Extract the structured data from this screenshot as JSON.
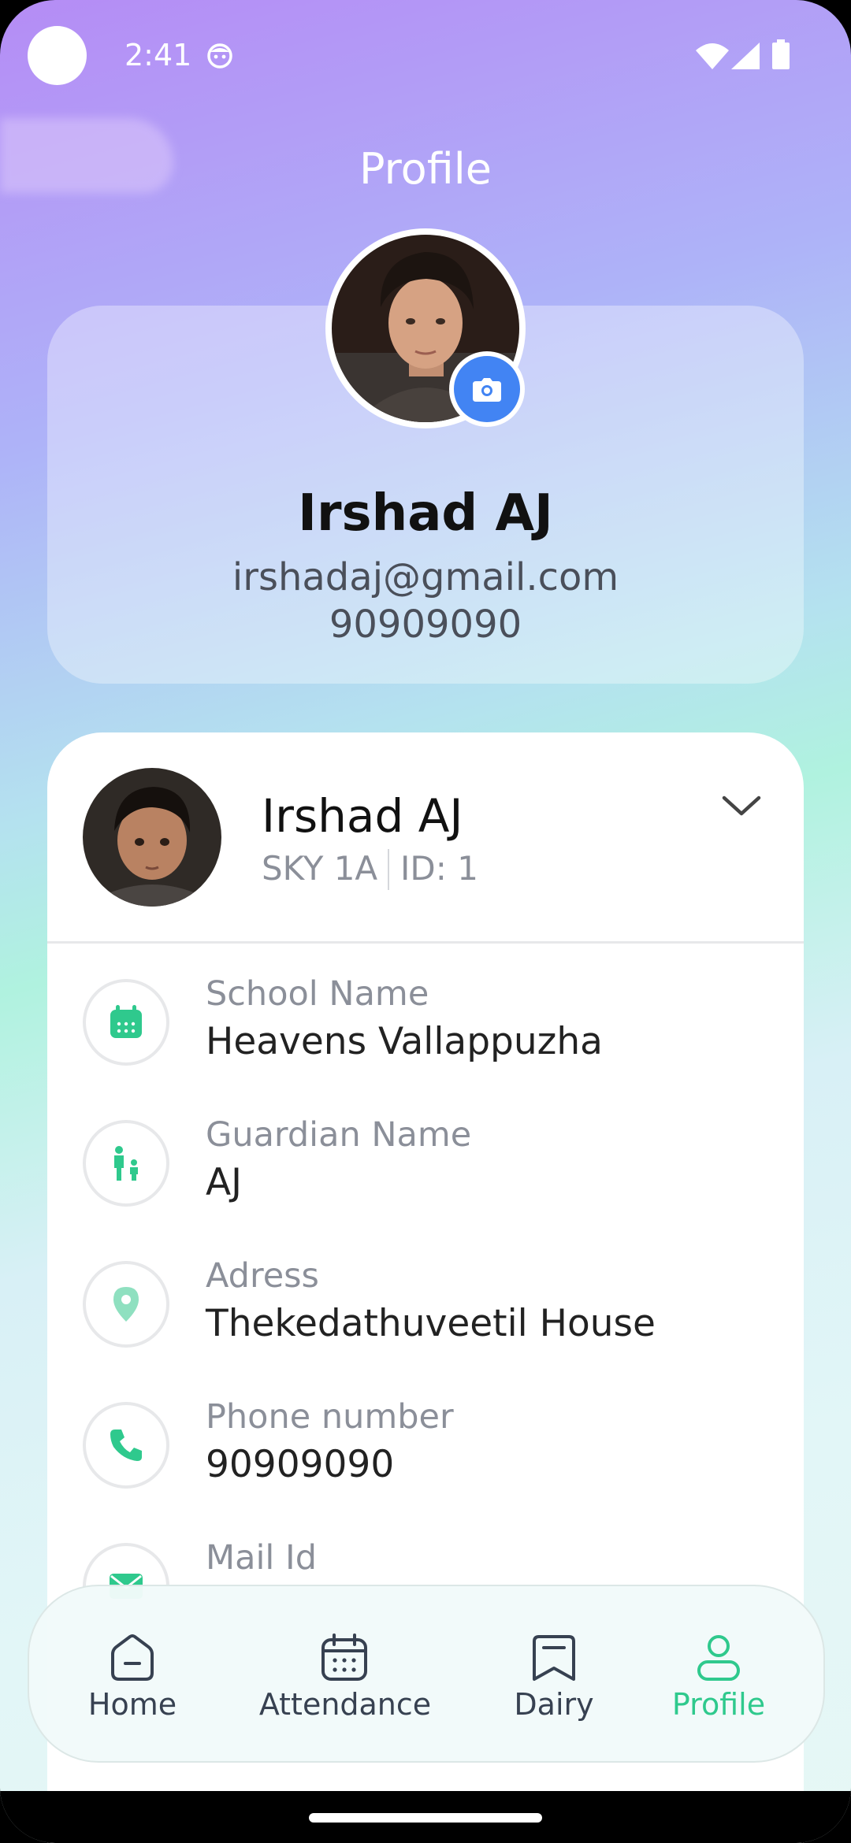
{
  "status_bar": {
    "time": "2:41"
  },
  "page": {
    "title": "Profile"
  },
  "user": {
    "name": "Irshad AJ",
    "email": "irshadaj@gmail.com",
    "phone": "90909090"
  },
  "child": {
    "name": "Irshad AJ",
    "class": "SKY 1A",
    "id": "ID: 1"
  },
  "details": [
    {
      "label": "School Name",
      "value": "Heavens Vallappuzha",
      "icon": "calendar-icon"
    },
    {
      "label": "Guardian Name",
      "value": "AJ",
      "icon": "guardian-icon"
    },
    {
      "label": "Adress",
      "value": "Thekedathuveetil House",
      "icon": "location-pin-icon"
    },
    {
      "label": "Phone number",
      "value": "90909090",
      "icon": "phone-icon"
    },
    {
      "label": "Mail Id",
      "value": "",
      "icon": "mail-icon"
    }
  ],
  "nav": {
    "items": [
      {
        "label": "Home",
        "icon": "home-icon"
      },
      {
        "label": "Attendance",
        "icon": "attendance-icon"
      },
      {
        "label": "Dairy",
        "icon": "dairy-icon"
      },
      {
        "label": "Profile",
        "icon": "profile-icon"
      }
    ],
    "active": "Profile"
  },
  "colors": {
    "accent": "#2fc98d",
    "camera_button": "#4284f3"
  }
}
